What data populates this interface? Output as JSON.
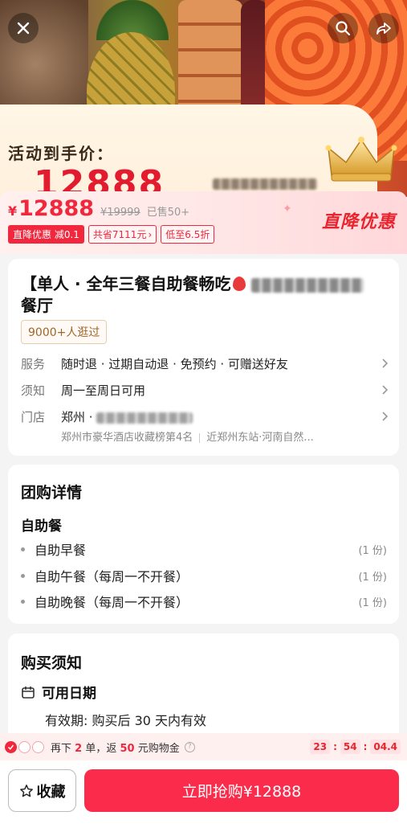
{
  "hero": {
    "activity_label": "活动到手价：",
    "big_price": "12888"
  },
  "price_band": {
    "currency": "¥",
    "price": "12888",
    "original_price": "¥19999",
    "sold": "已售50+",
    "tags": [
      "直降优惠 减0.1",
      "共省7111元",
      "低至6.5折"
    ],
    "promo": "直降优惠"
  },
  "product": {
    "title_prefix": "【单人 · 全年三餐自助餐畅吃",
    "title_suffix": "餐厅",
    "visit_tag": "9000+人逛过",
    "rows": [
      {
        "key": "服务",
        "value": "随时退 · 过期自动退 · 免预约 · 可赠送好友"
      },
      {
        "key": "须知",
        "value": "周一至周日可用"
      },
      {
        "key": "门店",
        "value": "郑州 ·"
      }
    ],
    "store_rank": "郑州市豪华酒店收藏榜第4名",
    "store_location": "近郑州东站·河南自然..."
  },
  "deal": {
    "section_title": "团购详情",
    "group_title": "自助餐",
    "items": [
      {
        "name": "自助早餐",
        "qty": "(1 份)"
      },
      {
        "name": "自助午餐（每周一不开餐）",
        "qty": "(1 份)"
      },
      {
        "name": "自助晚餐（每周一不开餐）",
        "qty": "(1 份)"
      }
    ]
  },
  "notice": {
    "section_title": "购买须知",
    "date_label": "可用日期",
    "validity": "有效期: 购买后 30 天内有效"
  },
  "coupon": {
    "pre": "再下",
    "count": "2",
    "mid": "单，返",
    "amount": "50",
    "post": "元购物金",
    "timer": [
      "23",
      "54",
      "04.4"
    ]
  },
  "bottom": {
    "favorite": "收藏",
    "buy": "立即抢购¥12888"
  },
  "colors": {
    "accent": "#f0273d",
    "buy_button": "#fb2c4b"
  }
}
